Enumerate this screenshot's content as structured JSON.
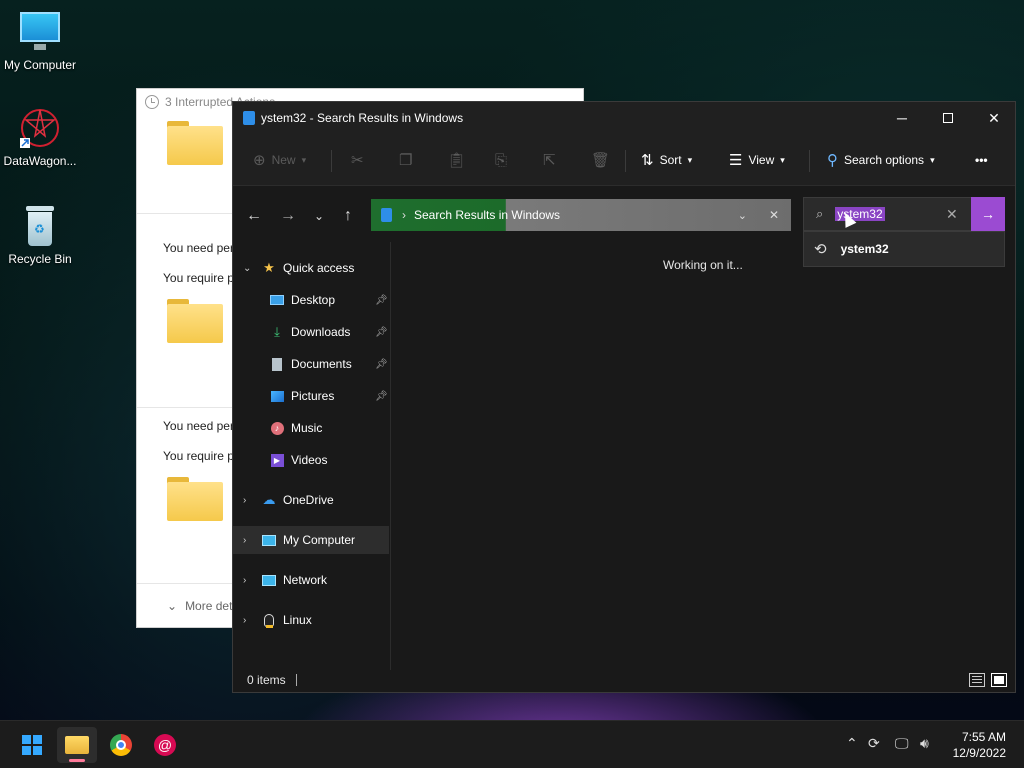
{
  "desktop": {
    "icons": [
      {
        "label": "My Computer"
      },
      {
        "label": "DataWagon..."
      },
      {
        "label": "Recycle Bin"
      }
    ]
  },
  "bg_dialog": {
    "title": "3 Interrupted Actions",
    "line1a": "You need per",
    "line1b": "You require p",
    "line2a": "You need per",
    "line2b": "You require p",
    "more": "More det"
  },
  "explorer": {
    "title": "ystem32 - Search Results in Windows",
    "toolbar": {
      "new": "New",
      "sort": "Sort",
      "view": "View",
      "search_options": "Search options",
      "more": "•••"
    },
    "address": {
      "text": "Search Results in Windows"
    },
    "search": {
      "value": "ystem32",
      "suggestion": "ystem32"
    },
    "sidebar": {
      "items": [
        {
          "label": "Quick access"
        },
        {
          "label": "Desktop"
        },
        {
          "label": "Downloads"
        },
        {
          "label": "Documents"
        },
        {
          "label": "Pictures"
        },
        {
          "label": "Music"
        },
        {
          "label": "Videos"
        },
        {
          "label": "OneDrive"
        },
        {
          "label": "My Computer"
        },
        {
          "label": "Network"
        },
        {
          "label": "Linux"
        }
      ]
    },
    "content": {
      "status": "Working on it..."
    },
    "statusbar": {
      "count": "0 items"
    }
  },
  "taskbar": {
    "time": "7:55 AM",
    "date": "12/9/2022"
  },
  "colors": {
    "accent": "#9b4bd2",
    "progress_green": "#1f6e2e",
    "folder_yellow": "#f5c94b"
  }
}
